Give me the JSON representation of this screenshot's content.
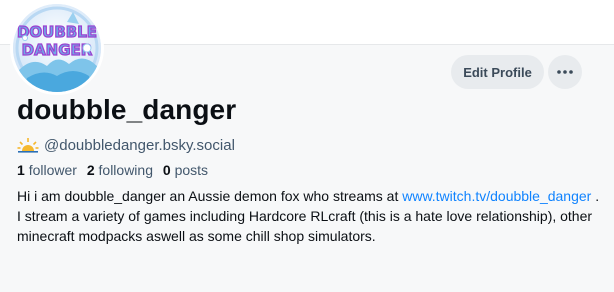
{
  "profile": {
    "display_name": "doubble_danger",
    "handle": "@doubbledanger.bsky.social",
    "avatar_text_line1": "DOUBBLE",
    "avatar_text_line2": "DANGER"
  },
  "actions": {
    "edit_profile_label": "Edit Profile",
    "more_label": "···"
  },
  "stats": {
    "followers_count": "1",
    "followers_label": "follower",
    "following_count": "2",
    "following_label": "following",
    "posts_count": "0",
    "posts_label": "posts"
  },
  "bio": {
    "text_before_link": "Hi i am doubble_danger an Aussie demon fox who streams at ",
    "link_text": "www.twitch.tv/doubble_danger",
    "text_after_link": " . I stream a variety of games including Hardcore RLcraft (this is a hate love relationship), other minecraft modpacks aswell as some chill shop simulators."
  },
  "icons": {
    "handle_icon": "sun-icon",
    "more_icon": "ellipsis-icon"
  },
  "colors": {
    "link": "#1083fe",
    "button_bg": "#e8ebee",
    "secondary_text": "#42576c",
    "primary_text": "#0b0f14",
    "card_bg": "#f7f8f9"
  }
}
